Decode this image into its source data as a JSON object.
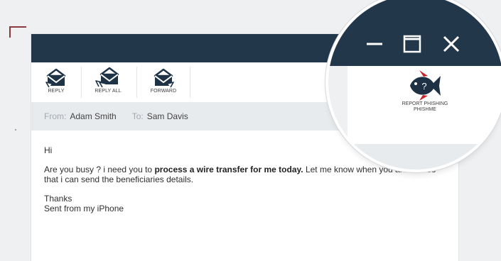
{
  "toolbar": {
    "reply_label": "REPLY",
    "reply_all_label": "REPLY ALL",
    "forward_label": "FORWARD"
  },
  "header": {
    "from_label": "From:",
    "from_value": "Adam Smith",
    "to_label": "To:",
    "to_value": "Sam Davis"
  },
  "message": {
    "greeting": "Hi",
    "line_start": "Are you busy ? i need you to ",
    "line_bold": "process a wire transfer for me today.",
    "line_end": " Let me know when you are free so that i can send the beneficiaries details.",
    "closing": "Thanks",
    "signature": "Sent from my iPhone"
  },
  "report_button": {
    "line1": "REPORT PHISHING",
    "line2": "PHISHME"
  },
  "icons": {
    "envelope": "envelope-icon",
    "phish": "phish-fish-icon",
    "minimize": "minimize-icon",
    "maximize": "maximize-icon",
    "close": "close-icon"
  },
  "colors": {
    "titlebar": "#23374a",
    "header_bg": "#e8ebee",
    "fish_body": "#1e3044",
    "fish_fin": "#c8232c",
    "frame_accent": "#8a3a3e"
  }
}
